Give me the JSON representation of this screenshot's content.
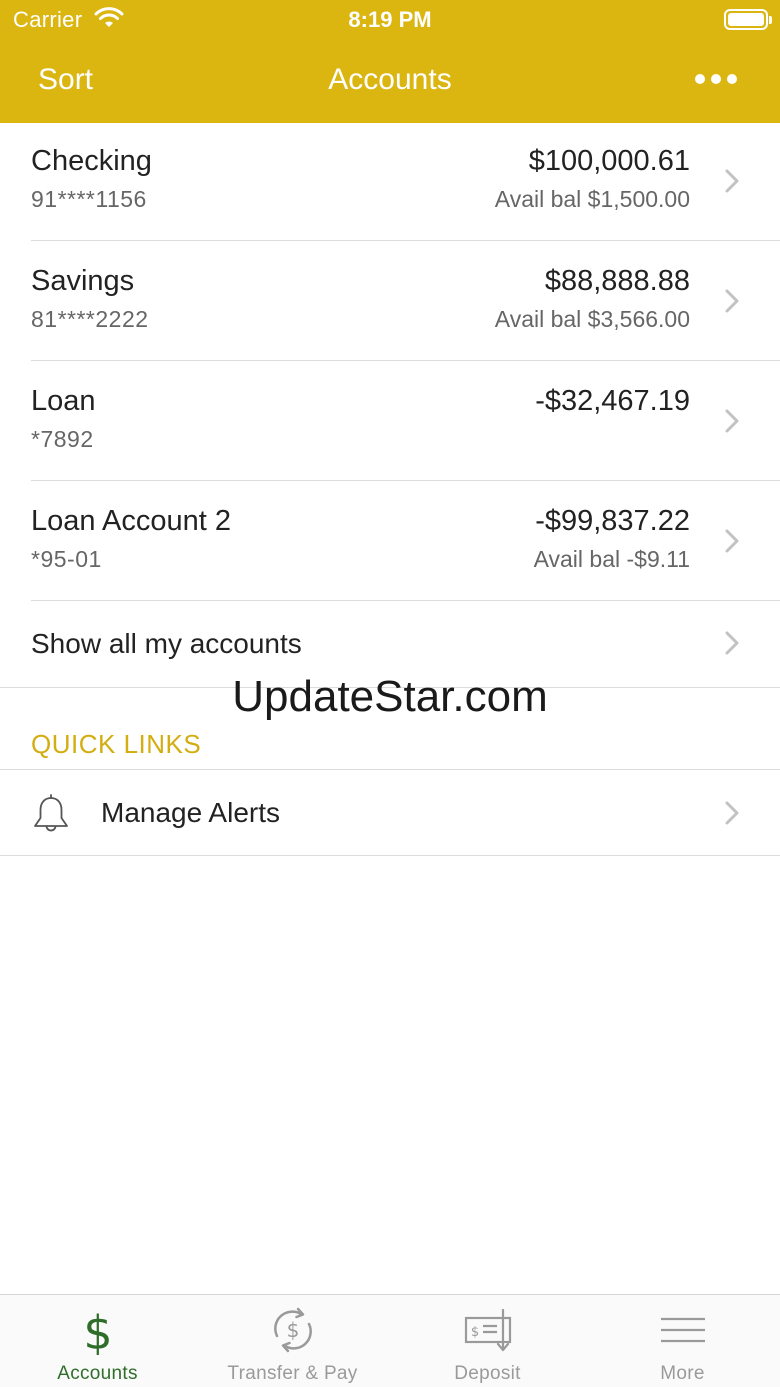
{
  "status_bar": {
    "carrier": "Carrier",
    "time": "8:19 PM"
  },
  "nav": {
    "sort_label": "Sort",
    "title": "Accounts"
  },
  "accounts": [
    {
      "name": "Checking",
      "number": "91****1156",
      "balance": "$100,000.61",
      "available": "Avail bal $1,500.00"
    },
    {
      "name": "Savings",
      "number": "81****2222",
      "balance": "$88,888.88",
      "available": "Avail bal $3,566.00"
    },
    {
      "name": "Loan",
      "number": "*7892",
      "balance": "-$32,467.19",
      "available": ""
    },
    {
      "name": "Loan Account 2",
      "number": "*95-01",
      "balance": "-$99,837.22",
      "available": "Avail bal -$9.11"
    }
  ],
  "show_all": {
    "label": "Show all my accounts"
  },
  "watermark": "UpdateStar.com",
  "quick_links": {
    "header": "QUICK LINKS",
    "items": [
      {
        "label": "Manage Alerts",
        "icon": "bell-icon"
      }
    ]
  },
  "tab_bar": {
    "items": [
      {
        "label": "Accounts",
        "icon": "dollar-icon",
        "active": true
      },
      {
        "label": "Transfer & Pay",
        "icon": "transfer-icon",
        "active": false
      },
      {
        "label": "Deposit",
        "icon": "deposit-check-icon",
        "active": false
      },
      {
        "label": "More",
        "icon": "hamburger-icon",
        "active": false
      }
    ]
  },
  "colors": {
    "brand": "#dbb510",
    "quick_links_header": "#d4ad12",
    "tab_active": "#2f6e2a",
    "tab_inactive": "#9a9a9a"
  }
}
